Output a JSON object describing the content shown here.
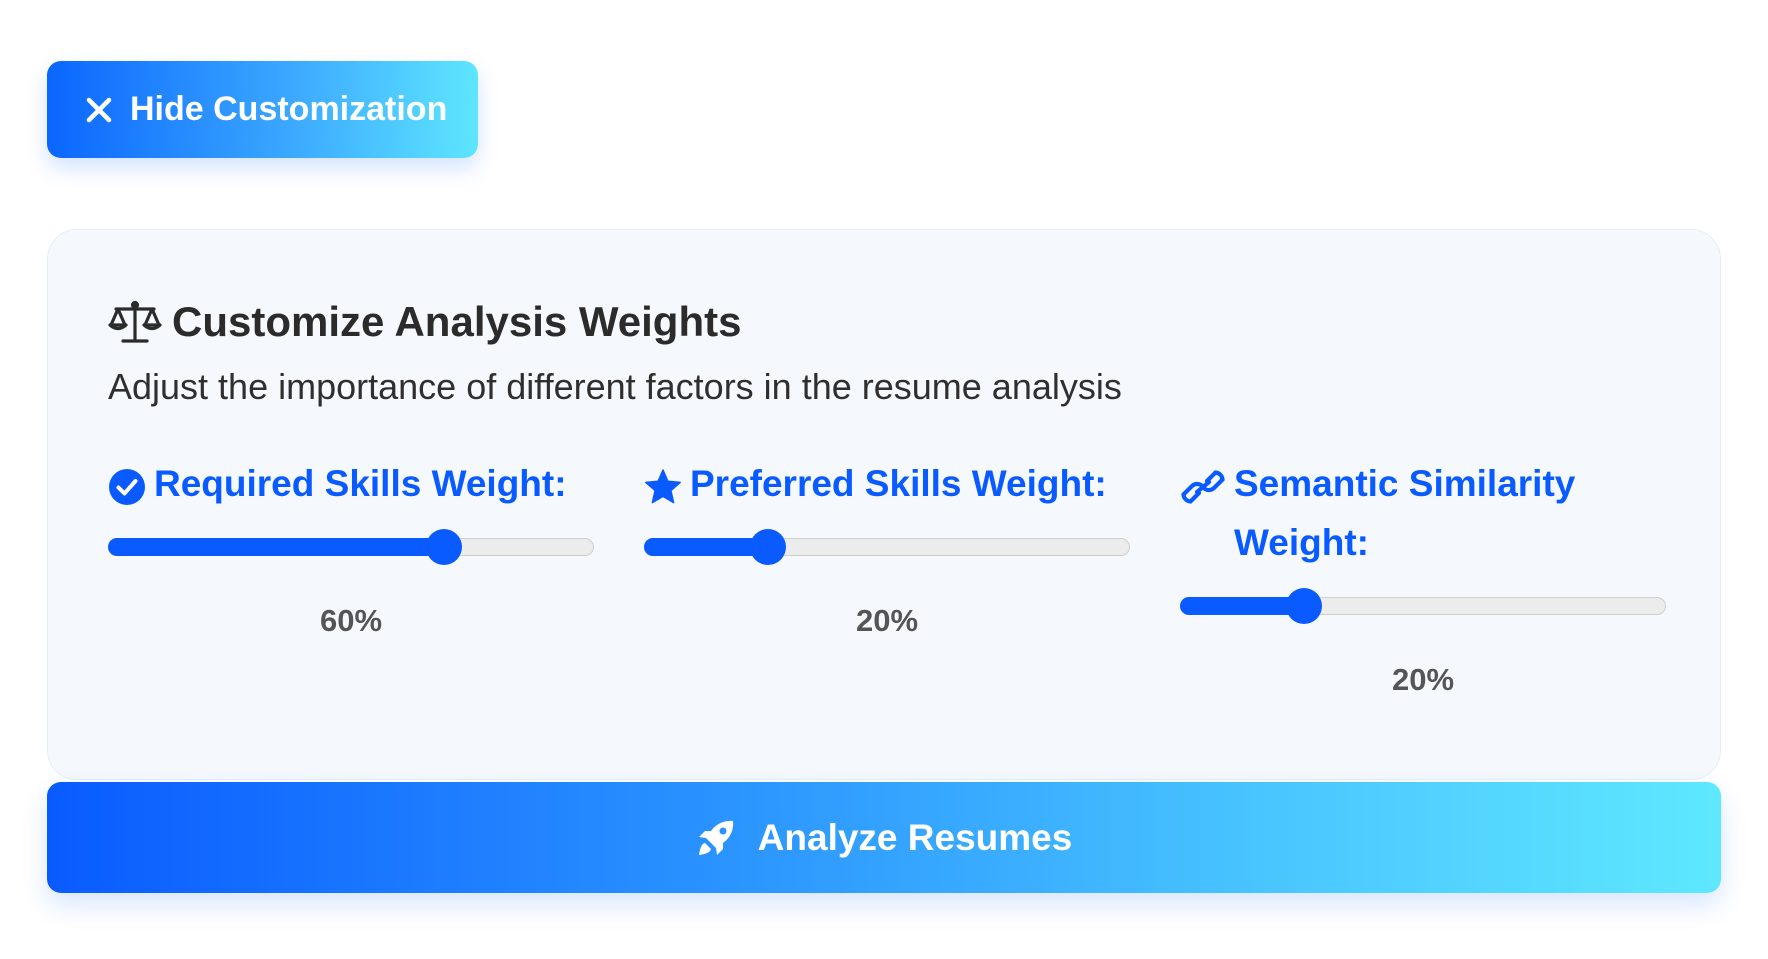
{
  "toggle": {
    "label": "Hide Customization",
    "icon": "close-icon"
  },
  "panel": {
    "title": "Customize Analysis Weights",
    "title_icon": "scale-icon",
    "description": "Adjust the importance of different factors in the resume analysis",
    "weights": [
      {
        "label": "Required Skills Weight:",
        "icon": "check-circle-icon",
        "value": 60,
        "value_text": "60%"
      },
      {
        "label": "Preferred Skills Weight:",
        "icon": "star-icon",
        "value": 20,
        "value_text": "20%"
      },
      {
        "label": "Semantic Similarity Weight:",
        "icon": "link-icon",
        "value": 20,
        "value_text": "20%"
      }
    ]
  },
  "analyze": {
    "label": "Analyze Resumes",
    "icon": "rocket-icon"
  },
  "colors": {
    "accent": "#0a5bff",
    "gradient_end": "#5ee8ff",
    "panel_bg": "#f5f9fd",
    "track": "#ececec"
  }
}
